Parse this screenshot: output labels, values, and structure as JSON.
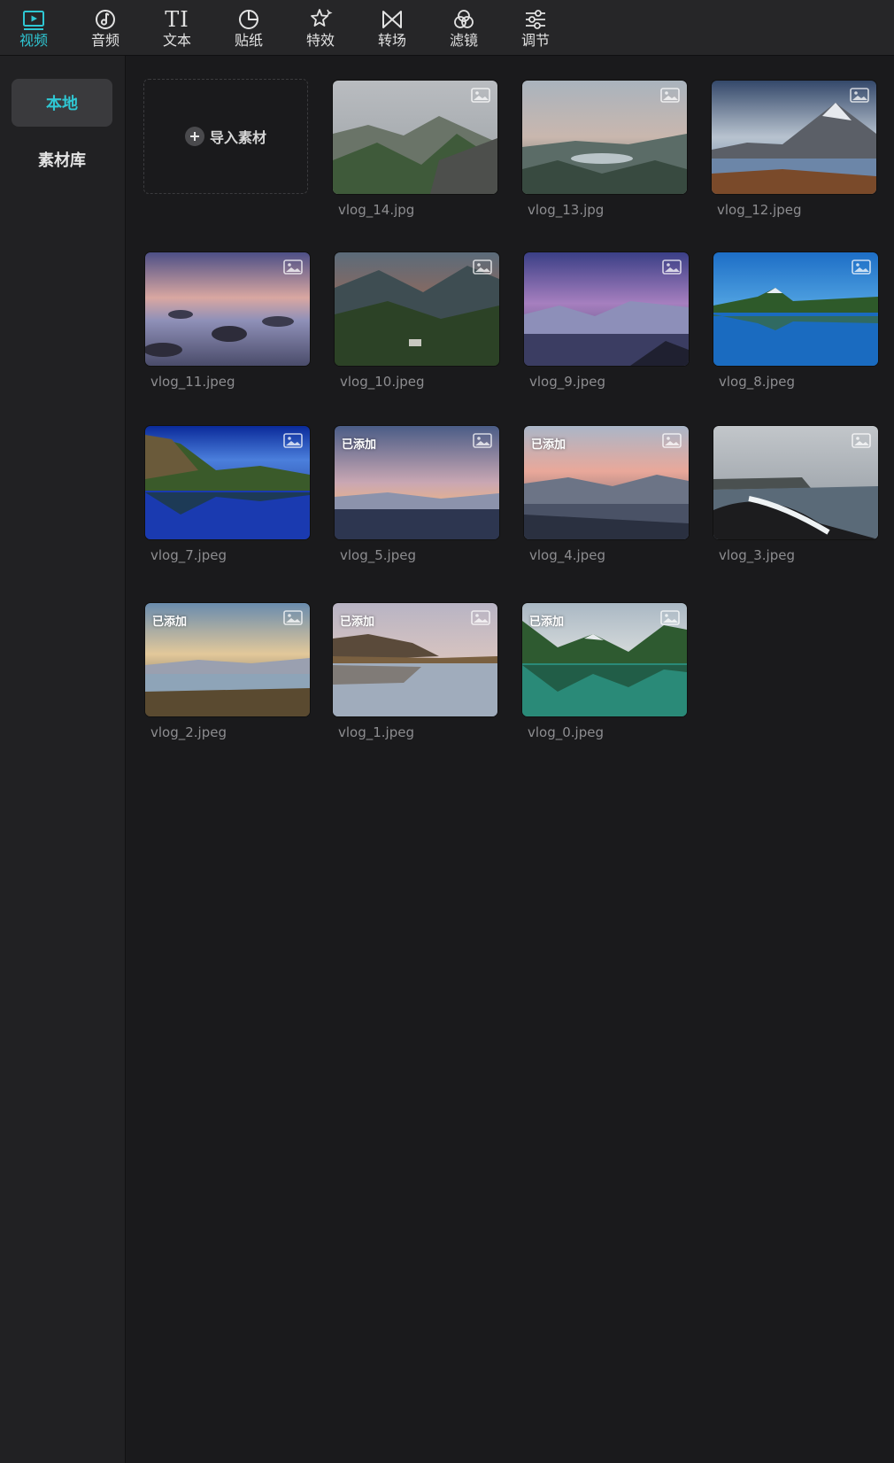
{
  "toolbar": {
    "tabs": [
      {
        "label": "视频",
        "icon": "video-icon",
        "active": true
      },
      {
        "label": "音频",
        "icon": "audio-icon",
        "active": false
      },
      {
        "label": "文本",
        "icon": "text-icon",
        "glyph": "TI",
        "active": false
      },
      {
        "label": "贴纸",
        "icon": "sticker-icon",
        "active": false
      },
      {
        "label": "特效",
        "icon": "effects-icon",
        "active": false
      },
      {
        "label": "转场",
        "icon": "transition-icon",
        "active": false
      },
      {
        "label": "滤镜",
        "icon": "filter-icon",
        "active": false
      },
      {
        "label": "调节",
        "icon": "adjust-icon",
        "active": false
      }
    ]
  },
  "sidebar": {
    "items": [
      {
        "label": "本地",
        "active": true
      },
      {
        "label": "素材库",
        "active": false
      }
    ]
  },
  "import": {
    "label": "导入素材"
  },
  "added_label": "已添加",
  "media": [
    {
      "name": "vlog_14.jpg",
      "added": false
    },
    {
      "name": "vlog_13.jpg",
      "added": false
    },
    {
      "name": "vlog_12.jpeg",
      "added": false
    },
    {
      "name": "vlog_11.jpeg",
      "added": false
    },
    {
      "name": "vlog_10.jpeg",
      "added": false
    },
    {
      "name": "vlog_9.jpeg",
      "added": false
    },
    {
      "name": "vlog_8.jpeg",
      "added": false
    },
    {
      "name": "vlog_7.jpeg",
      "added": false
    },
    {
      "name": "vlog_5.jpeg",
      "added": true
    },
    {
      "name": "vlog_4.jpeg",
      "added": true
    },
    {
      "name": "vlog_3.jpeg",
      "added": false
    },
    {
      "name": "vlog_2.jpeg",
      "added": true
    },
    {
      "name": "vlog_1.jpeg",
      "added": true
    },
    {
      "name": "vlog_0.jpeg",
      "added": true
    }
  ],
  "colors": {
    "accent": "#2fc7d3",
    "background": "#1a1a1c",
    "toolbar": "#262628",
    "sidebar": "#212123"
  }
}
